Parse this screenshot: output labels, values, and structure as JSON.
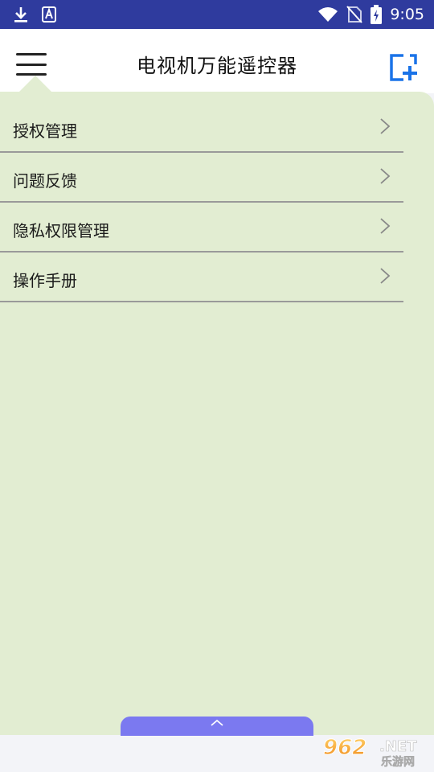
{
  "status_bar": {
    "time": "9:05",
    "icons": [
      "download-icon",
      "text-a-icon",
      "wifi-icon",
      "no-sim-icon",
      "battery-charging-icon"
    ]
  },
  "header": {
    "title": "电视机万能遥控器",
    "menu_icon": "hamburger-menu-icon",
    "add_icon": "add-device-icon",
    "accent_color": "#1a73e8"
  },
  "drawer": {
    "background": "#e2edd2",
    "items": [
      {
        "label": "授权管理"
      },
      {
        "label": "问题反馈"
      },
      {
        "label": "隐私权限管理"
      },
      {
        "label": "操作手册"
      }
    ]
  },
  "bottom_handle": {
    "icon": "chevron-up-icon",
    "color": "#7b79f0"
  },
  "watermark": {
    "brand_number": "962",
    "brand_suffix": ".NET",
    "brand_cn": "乐游网"
  }
}
